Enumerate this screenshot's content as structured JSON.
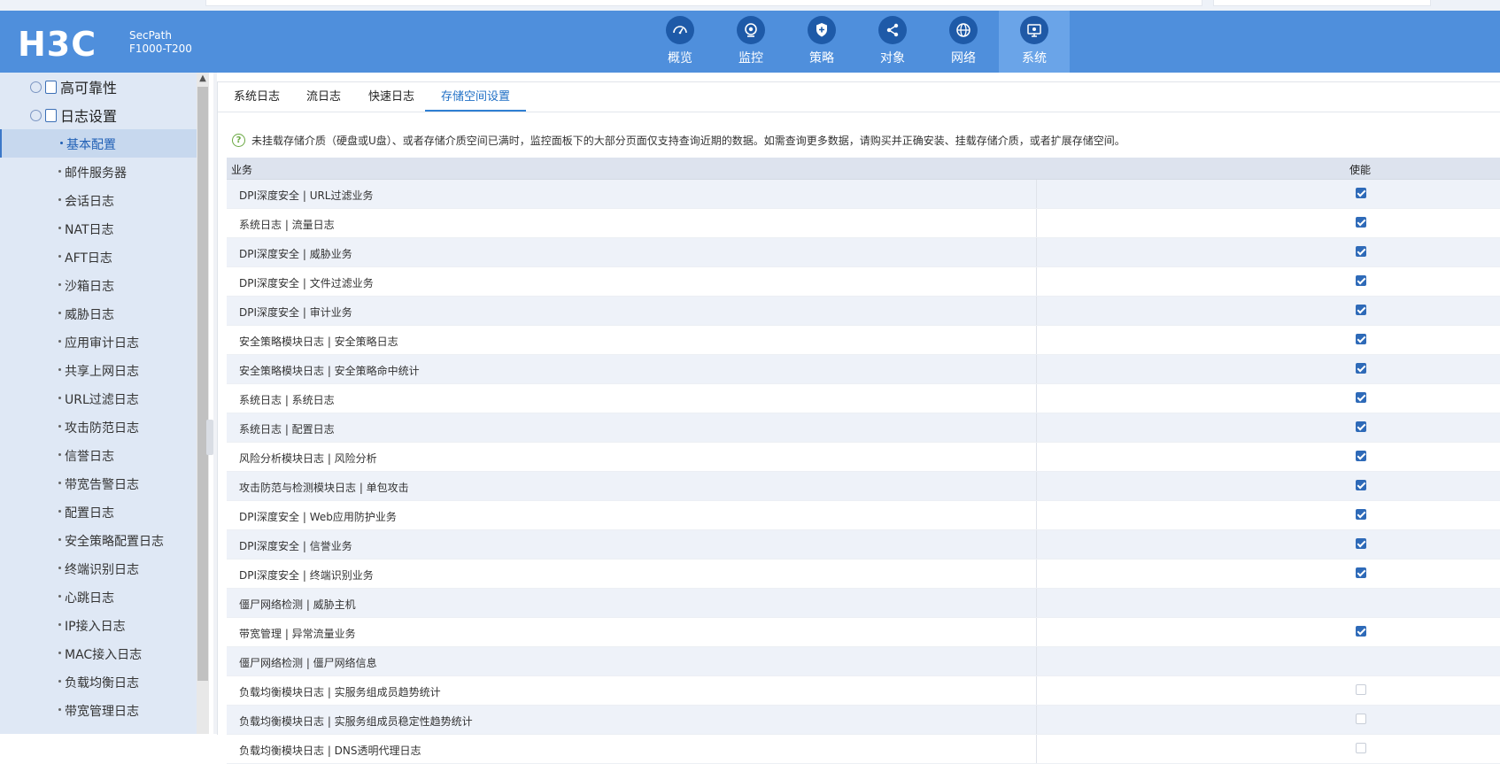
{
  "brand": {
    "logo": "H3C",
    "product_line1": "SecPath",
    "product_line2": "F1000-T200"
  },
  "nav": [
    {
      "label": "概览",
      "icon": "gauge-icon",
      "active": false
    },
    {
      "label": "监控",
      "icon": "camera-icon",
      "active": false
    },
    {
      "label": "策略",
      "icon": "shield-plus-icon",
      "active": false
    },
    {
      "label": "对象",
      "icon": "share-nodes-icon",
      "active": false
    },
    {
      "label": "网络",
      "icon": "globe-icon",
      "active": false
    },
    {
      "label": "系统",
      "icon": "monitor-gear-icon",
      "active": true
    }
  ],
  "sidebar": {
    "groups": [
      {
        "label": "高可靠性"
      },
      {
        "label": "日志设置"
      }
    ],
    "items": [
      {
        "label": "基本配置",
        "selected": true
      },
      {
        "label": "邮件服务器"
      },
      {
        "label": "会话日志"
      },
      {
        "label": "NAT日志"
      },
      {
        "label": "AFT日志"
      },
      {
        "label": "沙箱日志"
      },
      {
        "label": "威胁日志"
      },
      {
        "label": "应用审计日志"
      },
      {
        "label": "共享上网日志"
      },
      {
        "label": "URL过滤日志"
      },
      {
        "label": "攻击防范日志"
      },
      {
        "label": "信誉日志"
      },
      {
        "label": "带宽告警日志"
      },
      {
        "label": "配置日志"
      },
      {
        "label": "安全策略配置日志"
      },
      {
        "label": "终端识别日志"
      },
      {
        "label": "心跳日志"
      },
      {
        "label": "IP接入日志"
      },
      {
        "label": "MAC接入日志"
      },
      {
        "label": "负载均衡日志"
      },
      {
        "label": "带宽管理日志"
      }
    ]
  },
  "tabs": [
    {
      "label": "系统日志",
      "active": false
    },
    {
      "label": "流日志",
      "active": false
    },
    {
      "label": "快速日志",
      "active": false
    },
    {
      "label": "存储空间设置",
      "active": true
    }
  ],
  "notice": "未挂载存储介质（硬盘或U盘）、或者存储介质空间已满时，监控面板下的大部分页面仅支持查询近期的数据。如需查询更多数据，请购买并正确安装、挂载存储介质，或者扩展存储空间。",
  "table": {
    "headers": {
      "business": "业务",
      "enable": "使能"
    },
    "rows": [
      {
        "name": "DPI深度安全 | URL过滤业务",
        "state": "on"
      },
      {
        "name": "系统日志 | 流量日志",
        "state": "on"
      },
      {
        "name": "DPI深度安全 | 威胁业务",
        "state": "on"
      },
      {
        "name": "DPI深度安全 | 文件过滤业务",
        "state": "on"
      },
      {
        "name": "DPI深度安全 | 审计业务",
        "state": "on"
      },
      {
        "name": "安全策略模块日志 | 安全策略日志",
        "state": "on"
      },
      {
        "name": "安全策略模块日志 | 安全策略命中统计",
        "state": "on"
      },
      {
        "name": "系统日志 | 系统日志",
        "state": "on"
      },
      {
        "name": "系统日志 | 配置日志",
        "state": "on"
      },
      {
        "name": "风险分析模块日志 | 风险分析",
        "state": "on"
      },
      {
        "name": "攻击防范与检测模块日志 | 单包攻击",
        "state": "on"
      },
      {
        "name": "DPI深度安全 | Web应用防护业务",
        "state": "on"
      },
      {
        "name": "DPI深度安全 | 信誉业务",
        "state": "on"
      },
      {
        "name": "DPI深度安全 | 终端识别业务",
        "state": "on"
      },
      {
        "name": "僵尸网络检测 | 威胁主机",
        "state": "disabled"
      },
      {
        "name": "带宽管理 | 异常流量业务",
        "state": "on"
      },
      {
        "name": "僵尸网络检测 | 僵尸网络信息",
        "state": "disabled"
      },
      {
        "name": "负载均衡模块日志 | 实服务组成员趋势统计",
        "state": "off"
      },
      {
        "name": "负载均衡模块日志 | 实服务组成员稳定性趋势统计",
        "state": "off"
      },
      {
        "name": "负载均衡模块日志 | DNS透明代理日志",
        "state": "off"
      }
    ]
  }
}
